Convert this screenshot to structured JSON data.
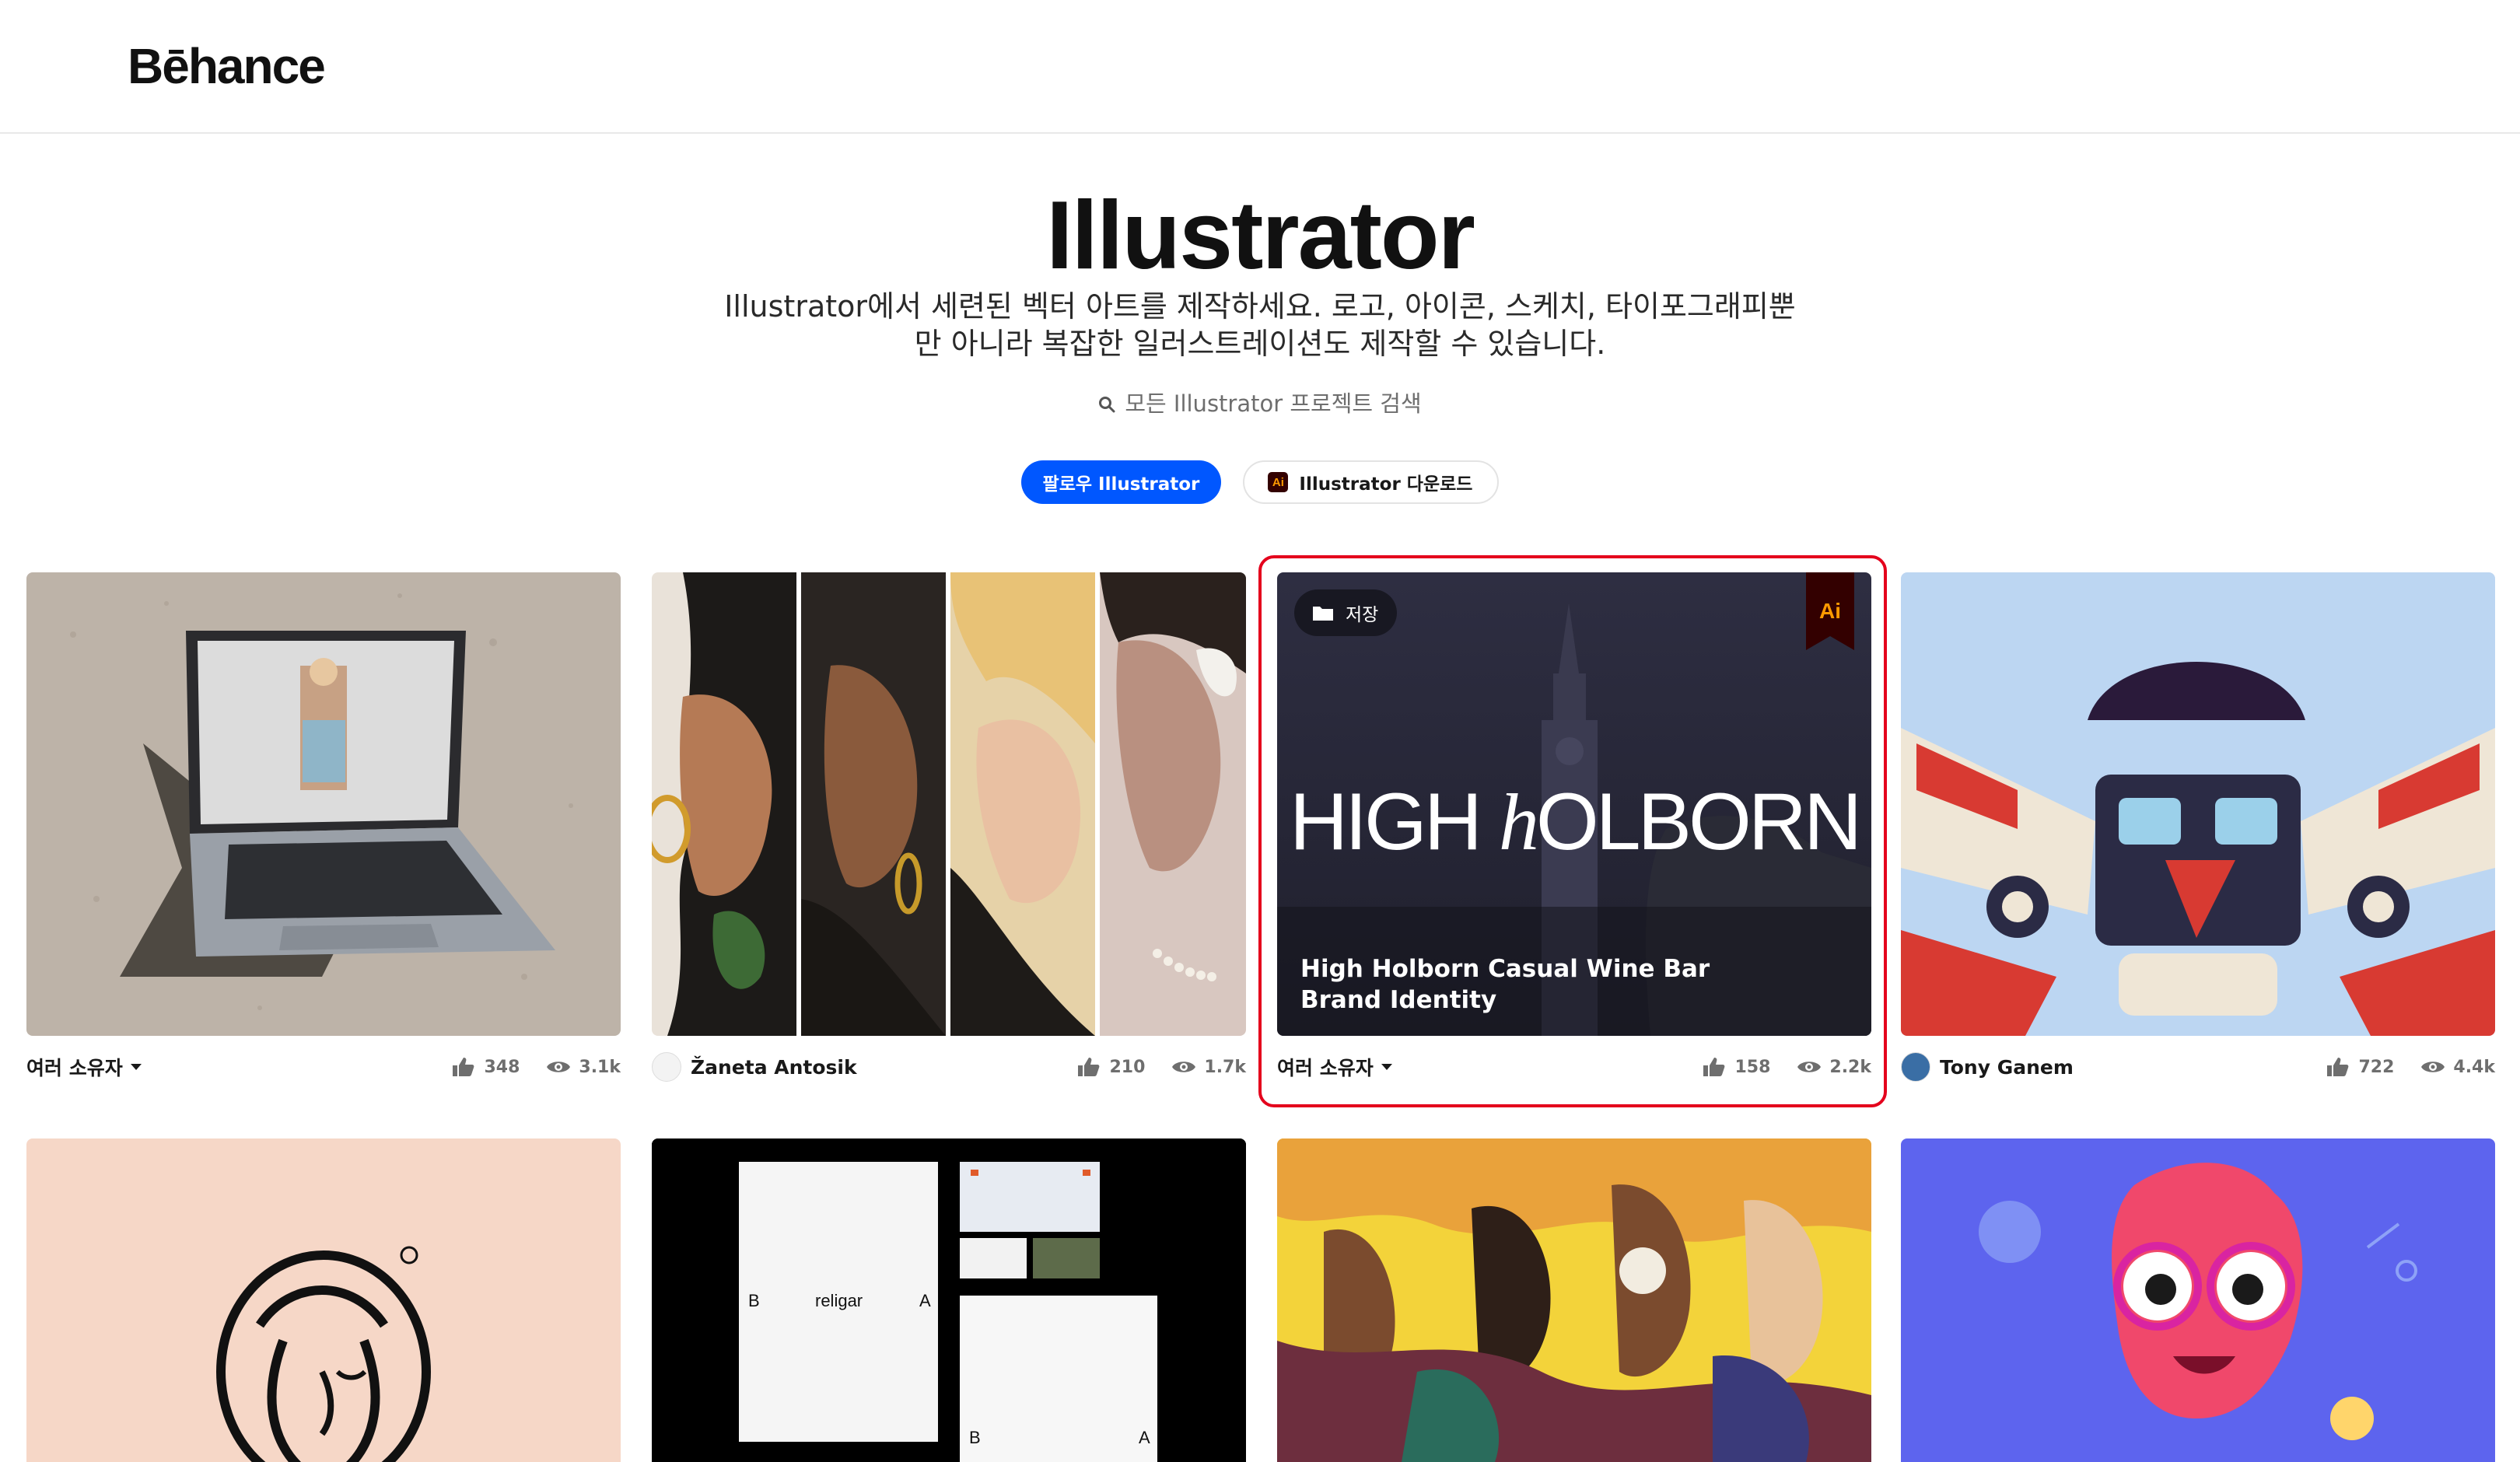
{
  "header": {
    "logo": "Bēhance"
  },
  "hero": {
    "title": "Illustrator",
    "description_line1": "Illustrator에서 세련된 벡터 아트를 제작하세요. 로고, 아이콘, 스케치, 타이포그래피뿐",
    "description_line2": "만 아니라 복잡한 일러스트레이션도 제작할 수 있습니다.",
    "search_placeholder": "모든 Illustrator 프로젝트 검색",
    "follow_label": "팔로우 Illustrator",
    "download_label": "Illustrator 다운로드",
    "download_icon_text": "Ai"
  },
  "colors": {
    "accent": "#0057ff",
    "highlight": "#e4001c",
    "ai_brand": "#ff9a00"
  },
  "cards": [
    {
      "owner": "여러 소유자",
      "multi_owner": true,
      "likes": "348",
      "views": "3.1k"
    },
    {
      "owner": "Žaneta Antosik",
      "multi_owner": false,
      "likes": "210",
      "views": "1.7k"
    },
    {
      "owner": "여러 소유자",
      "multi_owner": true,
      "likes": "158",
      "views": "2.2k",
      "save_label": "저장",
      "badge": "Ai",
      "logo_text_a": "HIGH ",
      "logo_text_b": "h",
      "logo_text_c": "OLBORN",
      "title": "High Holborn Casual Wine Bar Brand Identity"
    },
    {
      "owner": "Tony Ganem",
      "multi_owner": false,
      "likes": "722",
      "views": "4.4k"
    }
  ],
  "row2": {
    "card2_letters": {
      "b": "B",
      "word": "religar",
      "a": "A"
    }
  }
}
